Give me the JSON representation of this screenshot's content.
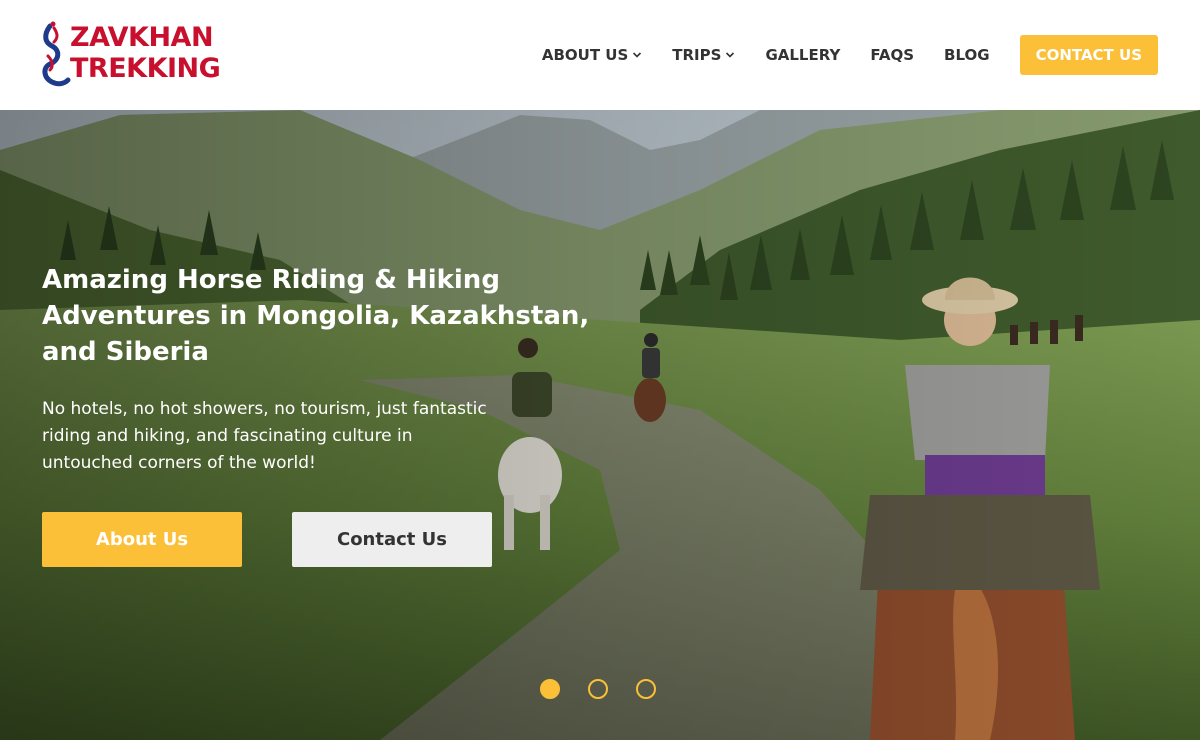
{
  "brand": {
    "logo_line1": "ZAVKHAN",
    "logo_line2": "TREKKING",
    "logo_color": "#c8102e",
    "mark_color": "#1f3a8a"
  },
  "nav": {
    "items": [
      {
        "label": "ABOUT US",
        "has_dropdown": true
      },
      {
        "label": "TRIPS",
        "has_dropdown": true
      },
      {
        "label": "GALLERY",
        "has_dropdown": false
      },
      {
        "label": "FAQS",
        "has_dropdown": false
      },
      {
        "label": "BLOG",
        "has_dropdown": false
      }
    ],
    "contact_label": "CONTACT US"
  },
  "hero": {
    "title": "Amazing Horse Riding & Hiking Adventures in Mongolia, Kazakhstan, and Siberia",
    "subtitle": "No hotels, no hot showers, no tourism, just fantastic riding and hiking, and fascinating culture in untouched corners of the world!",
    "primary_button": "About Us",
    "secondary_button": "Contact Us",
    "slides": {
      "count": 3,
      "active_index": 0
    }
  },
  "colors": {
    "accent": "#fbbf38",
    "nav_text": "#333333",
    "secondary_button_bg": "#eeeeee"
  },
  "icons": {
    "dropdown": "chevron-down-icon"
  }
}
